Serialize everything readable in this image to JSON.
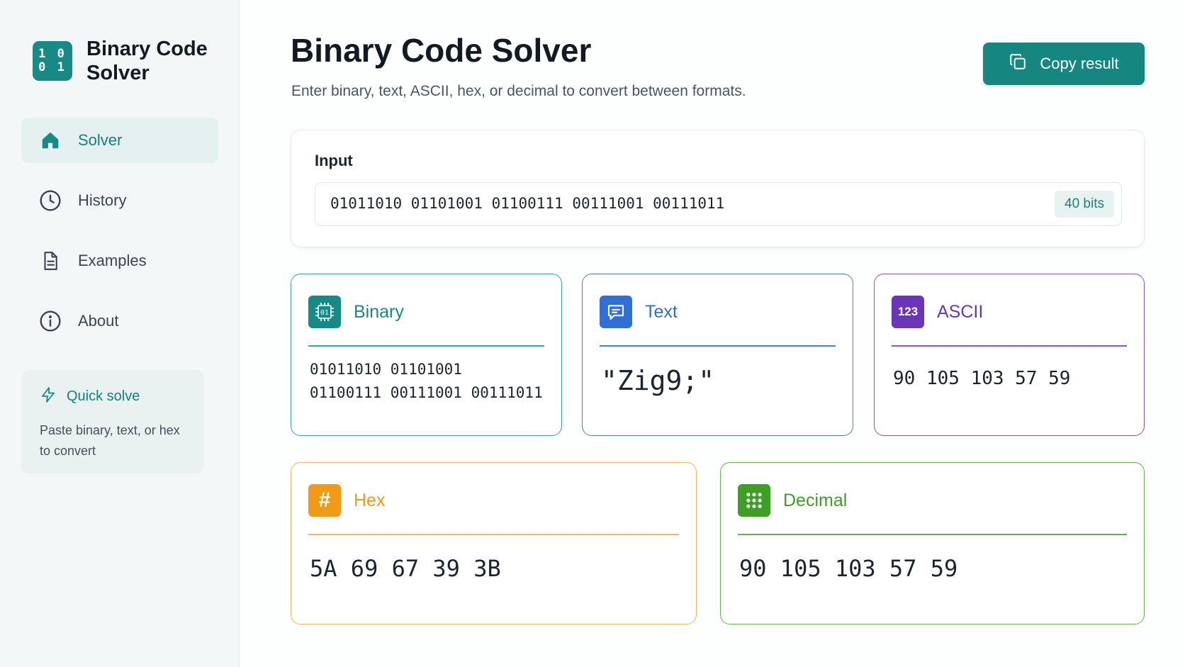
{
  "app": {
    "brand_logo_text": "1 0\n0 1",
    "brand_title": "Binary Code Solver"
  },
  "sidebar": {
    "items": [
      {
        "label": "Solver",
        "icon": "home-icon",
        "active": true
      },
      {
        "label": "History",
        "icon": "clock-icon",
        "active": false
      },
      {
        "label": "Examples",
        "icon": "document-icon",
        "active": false
      },
      {
        "label": "About",
        "icon": "info-icon",
        "active": false
      }
    ],
    "quick": {
      "title": "Quick solve",
      "description": "Paste binary, text, or hex to convert",
      "icon": "lightning-icon"
    }
  },
  "header": {
    "title": "Binary Code Solver",
    "subtitle": "Enter binary, text, ASCII, hex, or decimal to convert between formats.",
    "copy_button": "Copy result"
  },
  "input": {
    "label": "Input",
    "value": "01011010 01101001 01100111 00111001 00111011",
    "bits_badge": "40 bits"
  },
  "results": {
    "binary": {
      "title": "Binary",
      "icon": "chip-icon",
      "icon_text": "01",
      "value": "01011010 01101001\n01100111 00111001 00111011"
    },
    "text": {
      "title": "Text",
      "icon": "chat-icon",
      "value": "\"Zig9;\""
    },
    "ascii": {
      "title": "ASCII",
      "icon": "number-badge-icon",
      "icon_text": "123",
      "value": "90 105 103 57 59"
    },
    "hex": {
      "title": "Hex",
      "icon": "hash-icon",
      "icon_text": "#",
      "value": "5A 69 67 39 3B"
    },
    "decimal": {
      "title": "Decimal",
      "icon": "grid-dots-icon",
      "value": "90 105 103 57 59"
    }
  },
  "colors": {
    "primary": "#178a86",
    "binary": "#178a86",
    "text": "#2f6fd6",
    "ascii": "#6a35b8",
    "hex": "#f29a16",
    "decimal": "#3d9f24"
  }
}
